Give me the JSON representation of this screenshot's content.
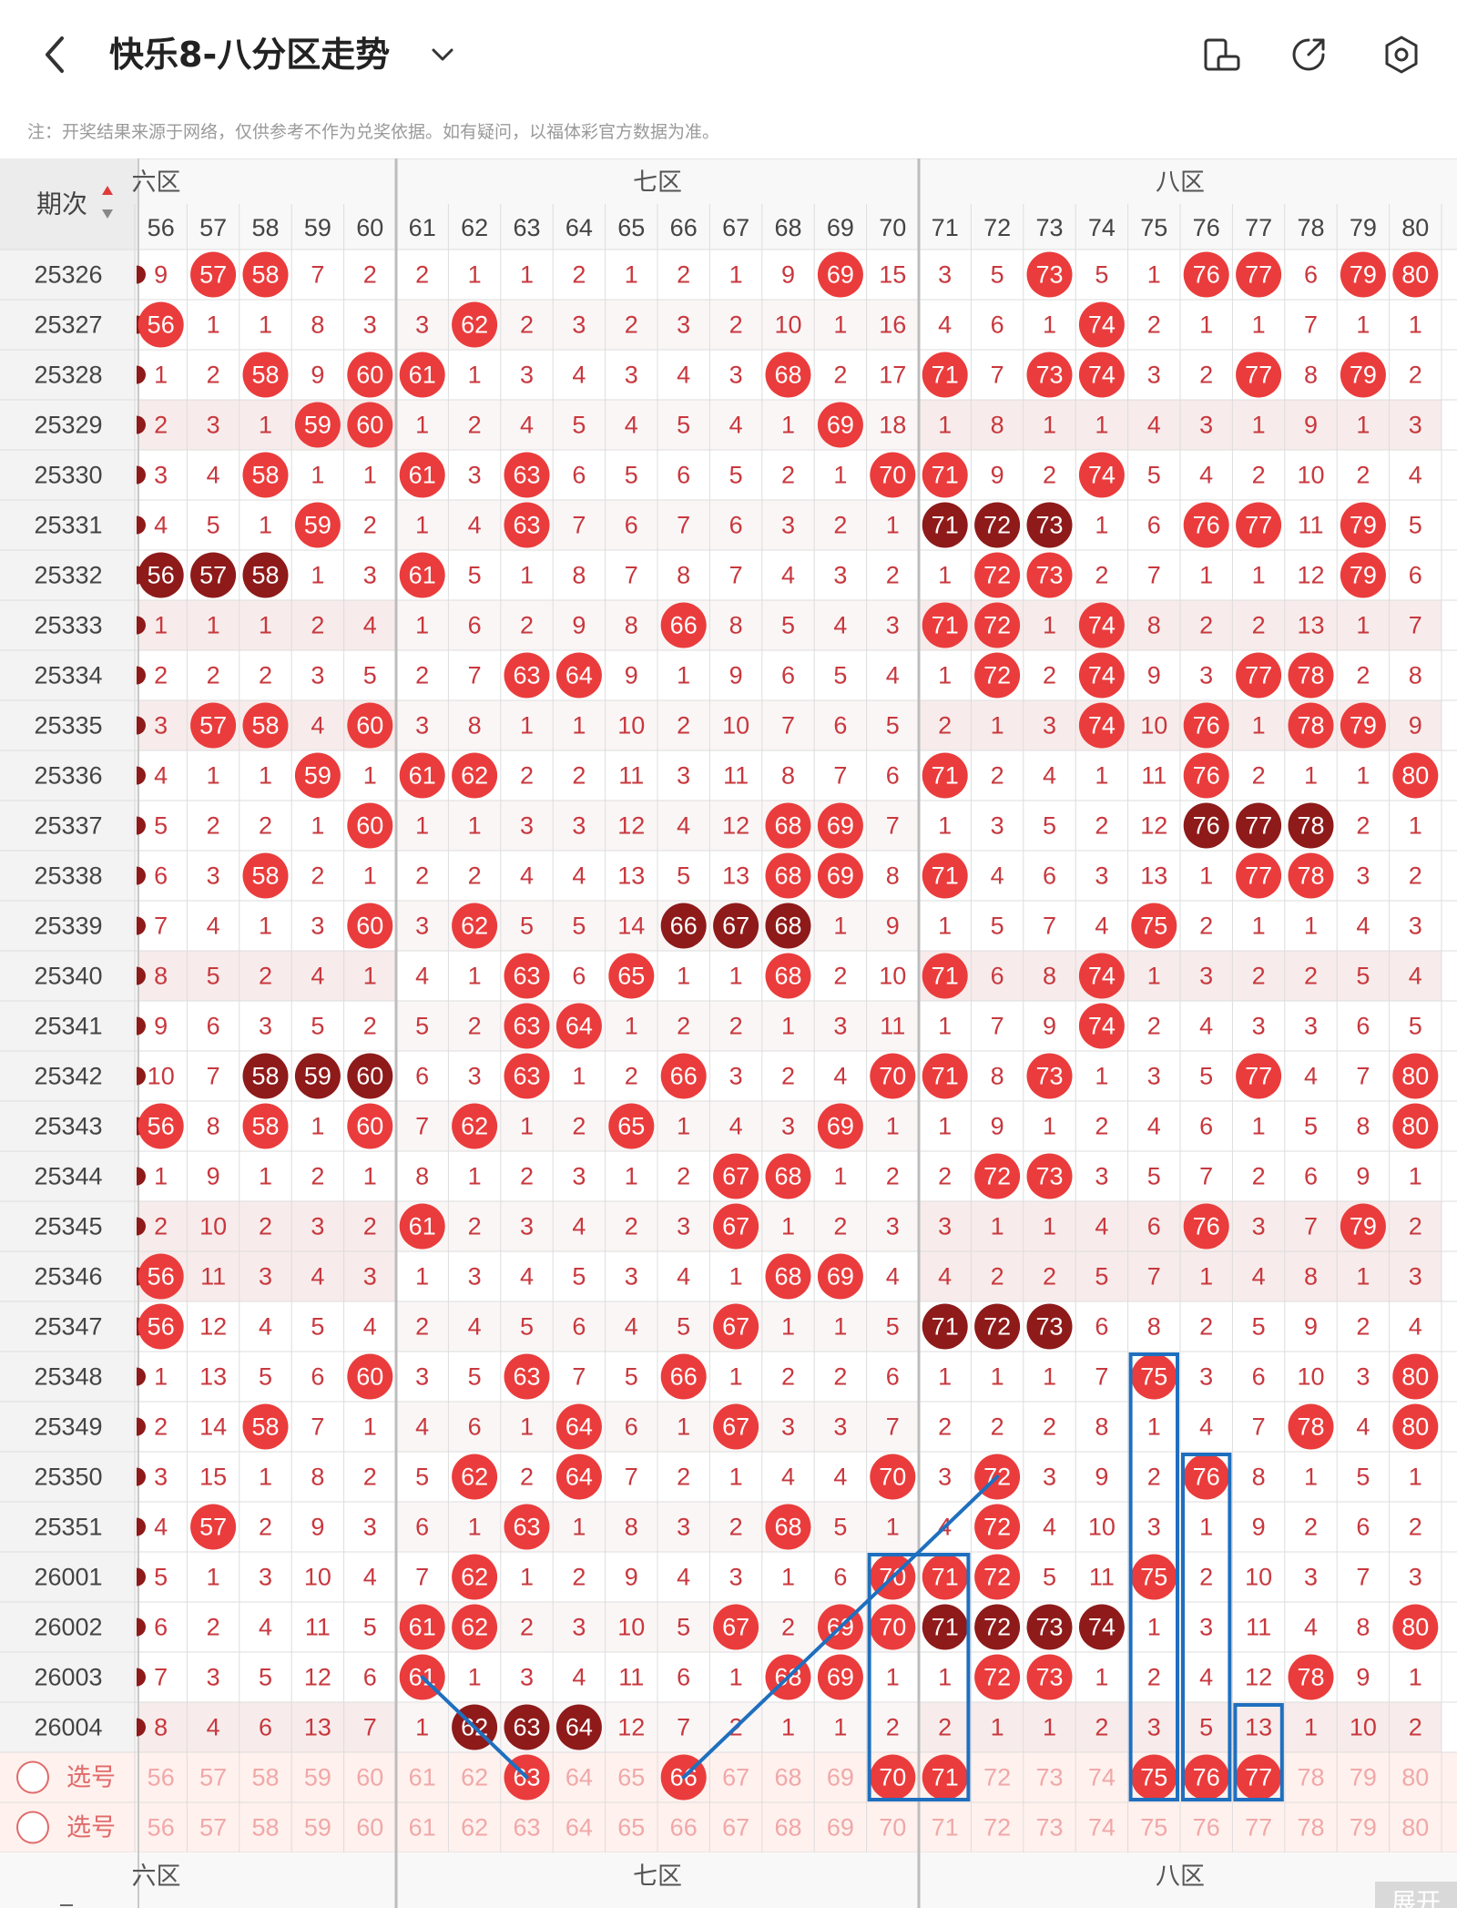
{
  "header": {
    "title": "快乐8-八分区走势"
  },
  "note": "注：开奖结果来源于网络，仅供参考不作为兑奖依据。如有疑问，以福体彩官方数据为准。",
  "table": {
    "period_header": "期次",
    "zones": [
      {
        "label": "六区"
      },
      {
        "label": "七区"
      },
      {
        "label": "八区"
      }
    ],
    "numbers": [
      56,
      57,
      58,
      59,
      60,
      61,
      62,
      63,
      64,
      65,
      66,
      67,
      68,
      69,
      70,
      71,
      72,
      73,
      74,
      75,
      76,
      77,
      78,
      79,
      80
    ],
    "rows": [
      {
        "period": "25326",
        "cells": [
          9,
          57,
          58,
          7,
          2,
          2,
          1,
          1,
          2,
          1,
          2,
          1,
          9,
          69,
          15,
          3,
          5,
          73,
          5,
          1,
          76,
          77,
          6,
          79,
          80
        ]
      },
      {
        "period": "25327",
        "cells": [
          56,
          1,
          1,
          8,
          3,
          3,
          62,
          2,
          3,
          2,
          3,
          2,
          10,
          1,
          16,
          4,
          6,
          1,
          74,
          2,
          1,
          1,
          7,
          1,
          1
        ]
      },
      {
        "period": "25328",
        "cells": [
          1,
          2,
          58,
          9,
          60,
          61,
          1,
          3,
          4,
          3,
          4,
          3,
          68,
          2,
          17,
          71,
          7,
          73,
          74,
          3,
          2,
          77,
          8,
          79,
          2
        ]
      },
      {
        "period": "25329",
        "cells": [
          2,
          3,
          1,
          59,
          60,
          1,
          2,
          4,
          5,
          4,
          5,
          4,
          1,
          69,
          18,
          1,
          8,
          1,
          1,
          4,
          3,
          1,
          9,
          1,
          3
        ]
      },
      {
        "period": "25330",
        "cells": [
          3,
          4,
          58,
          1,
          1,
          61,
          3,
          63,
          6,
          5,
          6,
          5,
          2,
          1,
          70,
          71,
          9,
          2,
          74,
          5,
          4,
          2,
          10,
          2,
          4
        ]
      },
      {
        "period": "25331",
        "cells": [
          4,
          5,
          1,
          59,
          2,
          1,
          4,
          63,
          7,
          6,
          7,
          6,
          3,
          2,
          1,
          71,
          72,
          73,
          1,
          6,
          76,
          77,
          11,
          79,
          5
        ]
      },
      {
        "period": "25332",
        "cells": [
          56,
          57,
          58,
          1,
          3,
          61,
          5,
          1,
          8,
          7,
          8,
          7,
          4,
          3,
          2,
          1,
          72,
          73,
          2,
          7,
          1,
          1,
          12,
          79,
          6
        ]
      },
      {
        "period": "25333",
        "cells": [
          1,
          1,
          1,
          2,
          4,
          1,
          6,
          2,
          9,
          8,
          66,
          8,
          5,
          4,
          3,
          71,
          72,
          1,
          74,
          8,
          2,
          2,
          13,
          1,
          7
        ]
      },
      {
        "period": "25334",
        "cells": [
          2,
          2,
          2,
          3,
          5,
          2,
          7,
          63,
          64,
          9,
          1,
          9,
          6,
          5,
          4,
          1,
          72,
          2,
          74,
          9,
          3,
          77,
          78,
          2,
          8
        ]
      },
      {
        "period": "25335",
        "cells": [
          3,
          57,
          58,
          4,
          60,
          3,
          8,
          1,
          1,
          10,
          2,
          10,
          7,
          6,
          5,
          2,
          1,
          3,
          74,
          10,
          76,
          1,
          78,
          79,
          9
        ]
      },
      {
        "period": "25336",
        "cells": [
          4,
          1,
          1,
          59,
          1,
          61,
          62,
          2,
          2,
          11,
          3,
          11,
          8,
          7,
          6,
          71,
          2,
          4,
          1,
          11,
          76,
          2,
          1,
          1,
          80
        ]
      },
      {
        "period": "25337",
        "cells": [
          5,
          2,
          2,
          1,
          60,
          1,
          1,
          3,
          3,
          12,
          4,
          12,
          68,
          69,
          7,
          1,
          3,
          5,
          2,
          12,
          76,
          77,
          78,
          2,
          1
        ]
      },
      {
        "period": "25338",
        "cells": [
          6,
          3,
          58,
          2,
          1,
          2,
          2,
          4,
          4,
          13,
          5,
          13,
          68,
          69,
          8,
          71,
          4,
          6,
          3,
          13,
          1,
          77,
          78,
          3,
          2
        ]
      },
      {
        "period": "25339",
        "cells": [
          7,
          4,
          1,
          3,
          60,
          3,
          62,
          5,
          5,
          14,
          66,
          67,
          68,
          1,
          9,
          1,
          5,
          7,
          4,
          75,
          2,
          1,
          1,
          4,
          3
        ]
      },
      {
        "period": "25340",
        "cells": [
          8,
          5,
          2,
          4,
          1,
          4,
          1,
          63,
          6,
          65,
          1,
          1,
          68,
          2,
          10,
          71,
          6,
          8,
          74,
          1,
          3,
          2,
          2,
          5,
          4
        ]
      },
      {
        "period": "25341",
        "cells": [
          9,
          6,
          3,
          5,
          2,
          5,
          2,
          63,
          64,
          1,
          2,
          2,
          1,
          3,
          11,
          1,
          7,
          9,
          74,
          2,
          4,
          3,
          3,
          6,
          5
        ]
      },
      {
        "period": "25342",
        "cells": [
          10,
          7,
          58,
          59,
          60,
          6,
          3,
          63,
          1,
          2,
          66,
          3,
          2,
          4,
          70,
          71,
          8,
          73,
          1,
          3,
          5,
          77,
          4,
          7,
          80
        ]
      },
      {
        "period": "25343",
        "cells": [
          56,
          8,
          58,
          1,
          60,
          7,
          62,
          1,
          2,
          65,
          1,
          4,
          3,
          69,
          1,
          1,
          9,
          1,
          2,
          4,
          6,
          1,
          5,
          8,
          80
        ]
      },
      {
        "period": "25344",
        "cells": [
          1,
          9,
          1,
          2,
          1,
          8,
          1,
          2,
          3,
          1,
          2,
          67,
          68,
          1,
          2,
          2,
          72,
          73,
          3,
          5,
          7,
          2,
          6,
          9,
          1
        ]
      },
      {
        "period": "25345",
        "cells": [
          2,
          10,
          2,
          3,
          2,
          61,
          2,
          3,
          4,
          2,
          3,
          67,
          1,
          2,
          3,
          3,
          1,
          1,
          4,
          6,
          76,
          3,
          7,
          79,
          2
        ]
      },
      {
        "period": "25346",
        "cells": [
          56,
          11,
          3,
          4,
          3,
          1,
          3,
          4,
          5,
          3,
          4,
          1,
          68,
          69,
          4,
          4,
          2,
          2,
          5,
          7,
          1,
          4,
          8,
          1,
          3
        ]
      },
      {
        "period": "25347",
        "cells": [
          56,
          12,
          4,
          5,
          4,
          2,
          4,
          5,
          6,
          4,
          5,
          67,
          1,
          1,
          5,
          71,
          72,
          73,
          6,
          8,
          2,
          5,
          9,
          2,
          4
        ]
      },
      {
        "period": "25348",
        "cells": [
          1,
          13,
          5,
          6,
          60,
          3,
          5,
          63,
          7,
          5,
          66,
          1,
          2,
          2,
          6,
          1,
          1,
          1,
          7,
          75,
          3,
          6,
          10,
          3,
          80
        ]
      },
      {
        "period": "25349",
        "cells": [
          2,
          14,
          58,
          7,
          1,
          4,
          6,
          1,
          64,
          6,
          1,
          67,
          3,
          3,
          7,
          2,
          2,
          2,
          8,
          1,
          4,
          7,
          78,
          4,
          80
        ]
      },
      {
        "period": "25350",
        "cells": [
          3,
          15,
          1,
          8,
          2,
          5,
          62,
          2,
          64,
          7,
          2,
          1,
          4,
          4,
          70,
          3,
          72,
          3,
          9,
          2,
          76,
          8,
          1,
          5,
          1
        ]
      },
      {
        "period": "25351",
        "cells": [
          4,
          57,
          2,
          9,
          3,
          6,
          1,
          63,
          1,
          8,
          3,
          2,
          68,
          5,
          1,
          4,
          72,
          4,
          10,
          3,
          1,
          9,
          2,
          6,
          2
        ]
      },
      {
        "period": "26001",
        "cells": [
          5,
          1,
          3,
          10,
          4,
          7,
          62,
          1,
          2,
          9,
          4,
          3,
          1,
          6,
          70,
          71,
          72,
          5,
          11,
          75,
          2,
          10,
          3,
          7,
          3
        ]
      },
      {
        "period": "26002",
        "cells": [
          6,
          2,
          4,
          11,
          5,
          61,
          62,
          2,
          3,
          10,
          5,
          67,
          2,
          69,
          70,
          71,
          72,
          73,
          74,
          1,
          3,
          11,
          4,
          8,
          80
        ]
      },
      {
        "period": "26003",
        "cells": [
          7,
          3,
          5,
          12,
          6,
          61,
          1,
          3,
          4,
          11,
          6,
          1,
          68,
          69,
          1,
          1,
          72,
          73,
          1,
          2,
          4,
          12,
          78,
          9,
          1
        ]
      },
      {
        "period": "26004",
        "cells": [
          8,
          4,
          6,
          13,
          7,
          1,
          62,
          63,
          64,
          12,
          7,
          2,
          1,
          1,
          2,
          2,
          1,
          1,
          2,
          3,
          5,
          13,
          1,
          10,
          2
        ]
      }
    ],
    "select_rows": [
      {
        "label": "选号",
        "selected": [
          63,
          66,
          70,
          71,
          75,
          76,
          77
        ]
      },
      {
        "label": "选号",
        "selected": []
      }
    ]
  },
  "bottom_button": "展开",
  "colors": {
    "ball_red": "#ea3c3c",
    "ball_dark": "#8e1a1a",
    "miss_text": "#c8383e",
    "zone_header": "#555555",
    "box_blue": "#1f6fbf",
    "grid_line": "#dddddd",
    "select_bg": "#fff1ee",
    "row_shade": "#f7eceb",
    "left_col_bg": "#f3f3f3"
  },
  "icons": [
    "back-arrow-icon",
    "chevron-down-icon",
    "landscape-phone-icon",
    "share-icon",
    "settings-icon"
  ]
}
